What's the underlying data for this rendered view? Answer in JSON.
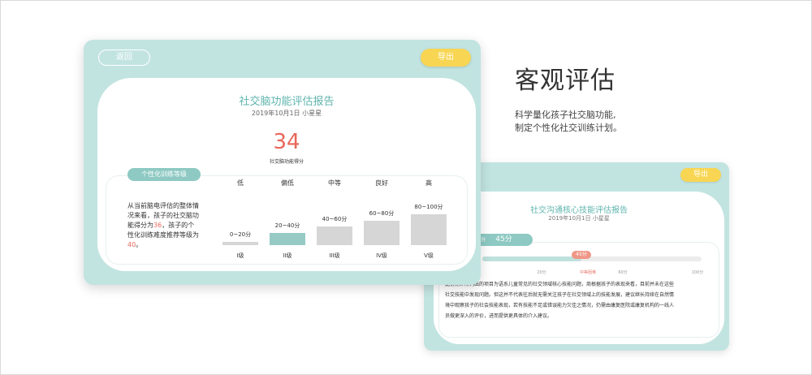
{
  "headline": {
    "title": "客观评估",
    "line1": "科学量化孩子社交脑功能,",
    "line2": "制定个性化社交训练计划。"
  },
  "front_card": {
    "back_label": "返回",
    "export_label": "导出",
    "title": "社交脑功能评估报告",
    "date_user": "2019年10月1日  小星星",
    "score": "34",
    "score_label": "社交脑功能得分",
    "tab_label": "个性化训练等级",
    "description": {
      "part1": "从当前脑电评估的整体情况来看，孩子的社交脑功能得分为",
      "score": "36",
      "part2": "，孩子的个性化训练难度推荐等级为",
      "level": "40",
      "part3": "。"
    },
    "levels": [
      {
        "top": "低",
        "range": "0~20分",
        "name": "I级",
        "value": 0.05,
        "active": false
      },
      {
        "top": "偏低",
        "range": "20~40分",
        "name": "II级",
        "value": 0.4,
        "active": true
      },
      {
        "top": "中等",
        "range": "40~60分",
        "name": "III级",
        "value": 0.6,
        "active": false
      },
      {
        "top": "良好",
        "range": "60~80分",
        "name": "IV级",
        "value": 0.8,
        "active": false
      },
      {
        "top": "高",
        "range": "80~100分",
        "name": "V级",
        "value": 1.0,
        "active": false
      }
    ]
  },
  "back_card": {
    "export_label": "导出",
    "title": "社交沟通核心技能评估报告",
    "date_user": "2019年10月1日  小星星",
    "tab_label": "分",
    "tab_score": "45分",
    "marker": "45分",
    "progress": 0.45,
    "ticks": [
      {
        "label": "20分",
        "pos": 0.27,
        "active": false
      },
      {
        "label": "中等困难",
        "pos": 0.48,
        "active": true
      },
      {
        "label": "60分",
        "pos": 0.64,
        "active": false
      },
      {
        "label": "100分",
        "pos": 0.98,
        "active": false
      }
    ],
    "text_lines": [
      "此份测评所列出的项目为语系儿童常见的社交领域核心技能问题，商根据孩子的表现来看，目前并未在这些",
      "社交技能中发现问题。但这并不代表往后就无需关注孩子在社交领域上的技能发展，建议继长持续在自然情",
      "境中观察孩子的社会技能表现，若有技能不足或错误能力欠佳之情况，仍需由康复医院或康复机构的一线人",
      "员做更深入的评价，进而提供更具体的介入建议。"
    ]
  }
}
